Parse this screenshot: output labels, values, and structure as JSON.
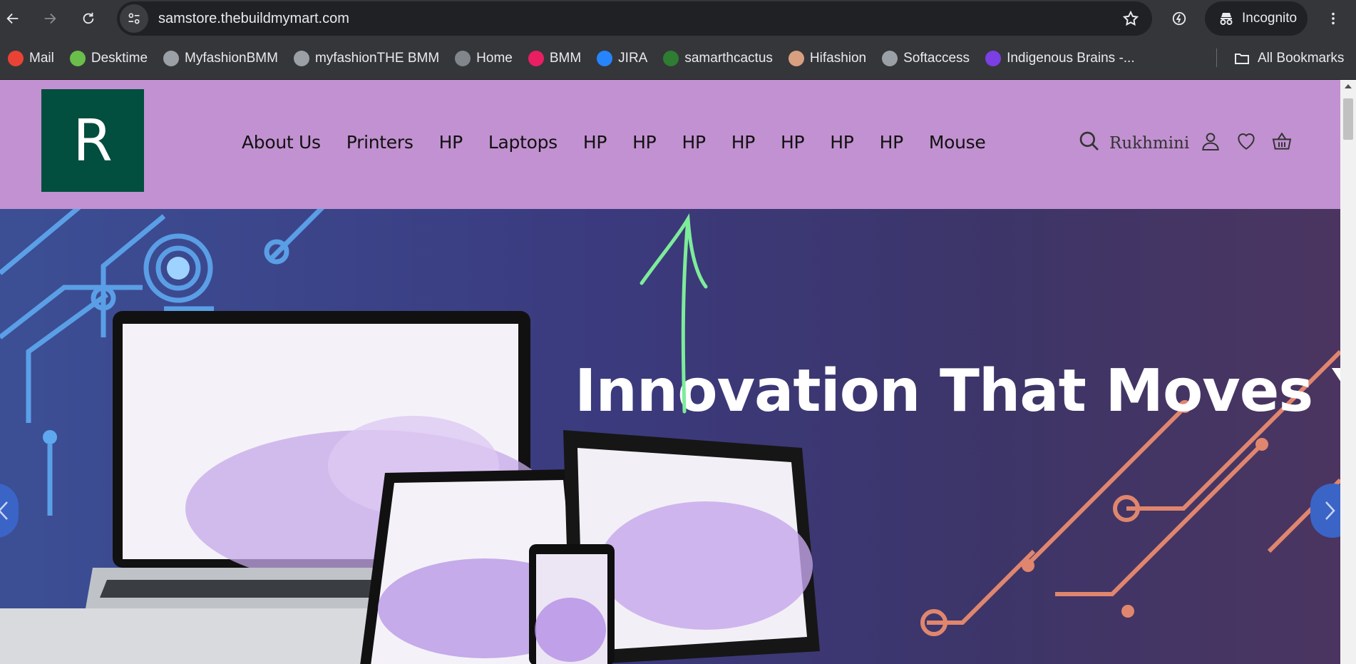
{
  "browser": {
    "url": "samstore.thebuildmymart.com",
    "profile_label": "Incognito",
    "bookmarks": [
      {
        "label": "Mail",
        "icon": "gmail-icon",
        "color": "#ea4335"
      },
      {
        "label": "Desktime",
        "icon": "desktime-icon",
        "color": "#6abf4b"
      },
      {
        "label": "MyfashionBMM",
        "icon": "globe-icon",
        "color": "#9aa0a6"
      },
      {
        "label": "myfashionTHE BMM",
        "icon": "globe-icon",
        "color": "#9aa0a6"
      },
      {
        "label": "Home",
        "icon": "globe-icon",
        "color": "#80868b"
      },
      {
        "label": "BMM",
        "icon": "bmm-icon",
        "color": "#e91e63"
      },
      {
        "label": "JIRA",
        "icon": "jira-icon",
        "color": "#2684ff"
      },
      {
        "label": "samarthcactus",
        "icon": "cactus-icon",
        "color": "#2e7d32"
      },
      {
        "label": "Hifashion",
        "icon": "hifashion-icon",
        "color": "#d7a080"
      },
      {
        "label": "Softaccess",
        "icon": "globe-icon",
        "color": "#9aa0a6"
      },
      {
        "label": "Indigenous Brains -...",
        "icon": "indigenous-icon",
        "color": "#7b3fe4"
      }
    ],
    "all_bookmarks_label": "All Bookmarks"
  },
  "site": {
    "logo_letter": "R",
    "colors": {
      "header_bg": "#c291d1",
      "logo_bg": "#024e3f"
    },
    "nav": [
      "About Us",
      "Printers",
      "HP",
      "Laptops",
      "HP",
      "HP",
      "HP",
      "HP",
      "HP",
      "HP",
      "HP",
      "Mouse"
    ],
    "username": "Rukhmini"
  },
  "hero": {
    "title": "Innovation That Moves You"
  }
}
